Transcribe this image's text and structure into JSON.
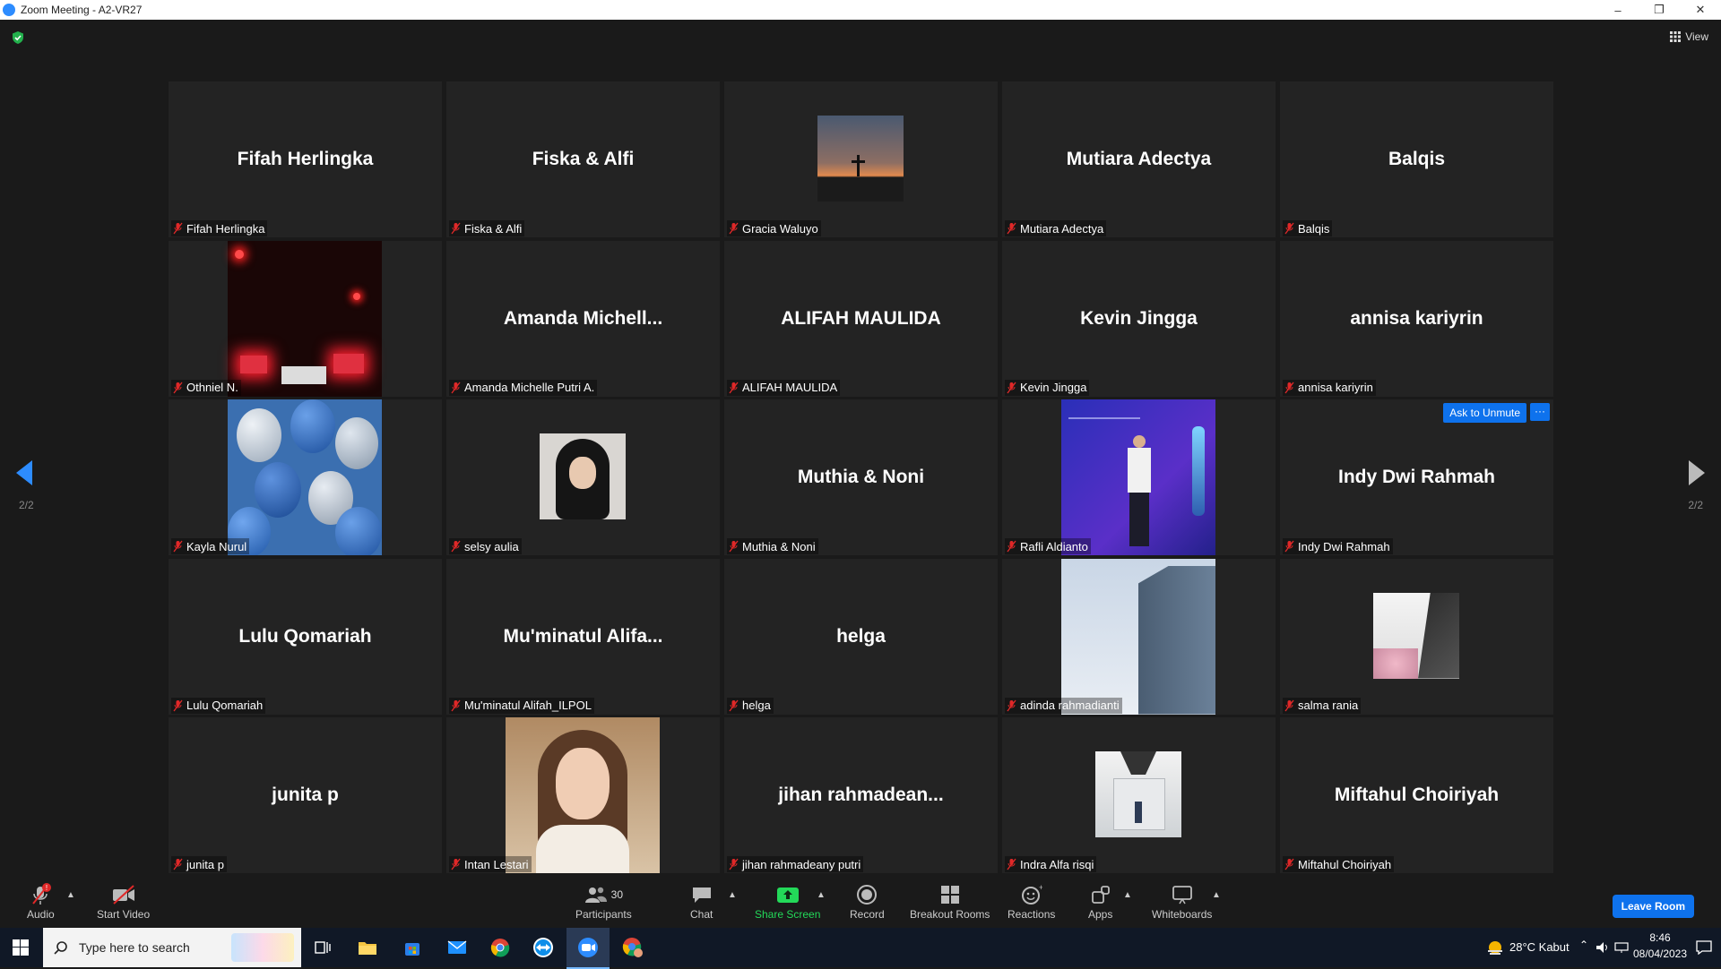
{
  "window": {
    "title": "Zoom Meeting - A2-VR27",
    "minimize": "–",
    "restore": "❐",
    "close": "✕"
  },
  "header": {
    "view_label": "View"
  },
  "pagination": {
    "left": "2/2",
    "right": "2/2"
  },
  "tiles": [
    {
      "display": "Fifah Herlingka",
      "name": "Fifah Herlingka"
    },
    {
      "display": "Fiska & Alfi",
      "name": "Fiska & Alfi"
    },
    {
      "display": "",
      "name": "Gracia Waluyo",
      "photo": "sunset-cross-photo"
    },
    {
      "display": "Mutiara Adectya",
      "name": "Mutiara Adectya"
    },
    {
      "display": "Balqis",
      "name": "Balqis"
    },
    {
      "display": "",
      "name": "Othniel N.",
      "photo": "night-traffic-photo"
    },
    {
      "display": "Amanda  Michell...",
      "name": "Amanda Michelle Putri A."
    },
    {
      "display": "ALIFAH MAULIDA",
      "name": "ALIFAH MAULIDA"
    },
    {
      "display": "Kevin Jingga",
      "name": "Kevin Jingga"
    },
    {
      "display": "annisa kariyrin",
      "name": "annisa kariyrin"
    },
    {
      "display": "",
      "name": "Kayla Nurul",
      "photo": "balloons-photo"
    },
    {
      "display": "",
      "name": "selsy aulia",
      "photo": "portrait-hijab-photo"
    },
    {
      "display": "Muthia & Noni",
      "name": "Muthia & Noni"
    },
    {
      "display": "",
      "name": "Rafli Aldianto",
      "photo": "conference-stage-photo"
    },
    {
      "display": "Indy Dwi Rahmah",
      "name": "Indy Dwi Rahmah",
      "ask_to_unmute": "Ask to Unmute",
      "more": "···"
    },
    {
      "display": "Lulu Qomariah",
      "name": "Lulu Qomariah"
    },
    {
      "display": "Mu'minatul  Alifa...",
      "name": "Mu'minatul Alifah_ILPOL"
    },
    {
      "display": "helga",
      "name": "helga"
    },
    {
      "display": "",
      "name": "adinda rahmadianti",
      "photo": "building-photo"
    },
    {
      "display": "",
      "name": "salma rania",
      "photo": "flowers-photo"
    },
    {
      "display": "junita p",
      "name": "junita p"
    },
    {
      "display": "",
      "name": "Intan Lestari",
      "photo": "selfie-photo"
    },
    {
      "display": "jihan  rahmadean...",
      "name": "jihan rahmadeany putri"
    },
    {
      "display": "",
      "name": "Indra Alfa risqi",
      "photo": "monument-photo"
    },
    {
      "display": "Miftahul Choiriyah",
      "name": "Miftahul Choiriyah"
    }
  ],
  "toolbar": {
    "audio": "Audio",
    "start_video": "Start Video",
    "participants": "Participants",
    "participants_count": "30",
    "chat": "Chat",
    "share_screen": "Share Screen",
    "record": "Record",
    "breakout_rooms": "Breakout Rooms",
    "reactions": "Reactions",
    "apps": "Apps",
    "whiteboards": "Whiteboards",
    "leave_room": "Leave Room",
    "audio_alert": "!"
  },
  "taskbar": {
    "search_placeholder": "Type here to search",
    "weather": "28°C  Kabut",
    "time": "8:46",
    "date": "08/04/2023"
  },
  "colors": {
    "accent": "#0e72ed",
    "share_green": "#23d959",
    "tile_bg": "#232323",
    "mute_red": "#e02828"
  }
}
